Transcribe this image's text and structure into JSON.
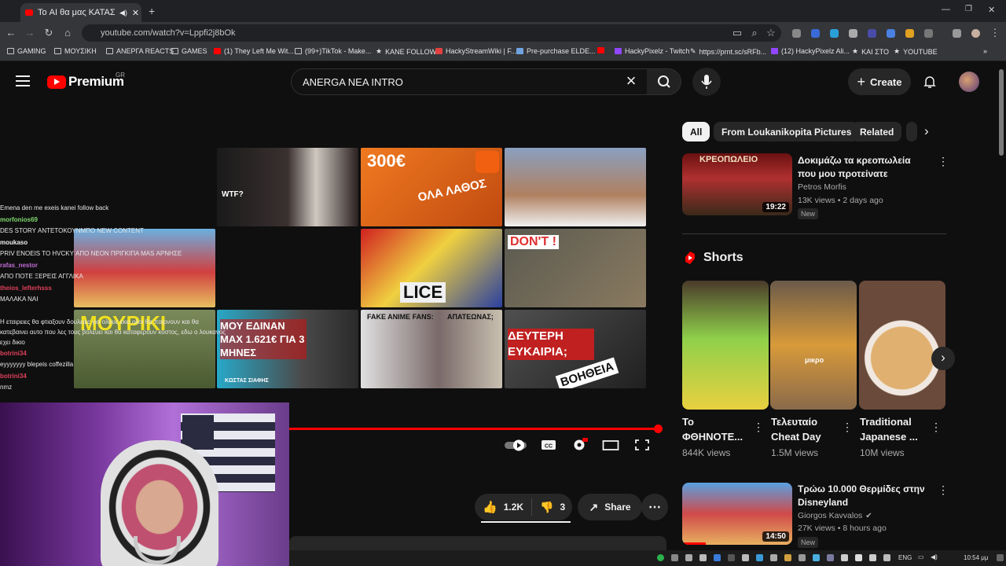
{
  "browser": {
    "tab_title": "Το AI θα μας ΚΑΤΑΣΤΡΕΨΕΙ",
    "url": "youtube.com/watch?v=Lppfi2j8bOk",
    "bookmarks": [
      "GAMING",
      "ΜΟΥΣΙΚΗ",
      "ΑΝΕΡΓΑ REACTS",
      "GAMES",
      "(1) They Left Me Wit...",
      "(99+)TikTok - Make...",
      "ΚΑΝΕ FOLLOW",
      "HackyStreamWiki | F...",
      "Pre-purchase ELDE...",
      "HackyPixelz - Twitch",
      "https://prnt.sc/sRFb...",
      "(12) HackyPixelz Ali...",
      "ΚΑΙ ΣΤΟ",
      "YOUTUBE"
    ]
  },
  "header": {
    "brand": "Premium",
    "country": "GR",
    "search_query": "ANERGA NEA INTRO",
    "create_label": "Create"
  },
  "endscreen": [
    {
      "text": "WTF?",
      "bg": "#2a2a2a"
    },
    {
      "text": "300€",
      "sub": "ΟΛΑ ΛΑΘΟΣ",
      "bg": "#e06a1a"
    },
    {
      "text": "",
      "bg": "#6e7f94"
    },
    {
      "text": "",
      "bg": "#c32020"
    },
    {
      "text": "DON'T !",
      "bg": "#40403a"
    },
    {
      "text": "",
      "bg": "#6aa6d4"
    },
    {
      "text": "ΜΟΥΡΙΚΙ",
      "bg": "#3a5a2a"
    },
    {
      "text": "ΜΟΥ ΕΔΙΝΑΝ ΜΑΧ 1.621€ ΓΙΑ 3 ΜΗΝΕΣ",
      "sub": "ΚΩΣΤΑΣ ΣΙΑΦΗΣ",
      "bg": "#20a0c0"
    },
    {
      "text": "FAKE ANIME FANS:",
      "sub": "ΑΠΑΤΕΩΝΑΣ;",
      "bg": "#d8d8d8"
    },
    {
      "text": "ΔΕΥΤΕΡΗ ΕΥΚΑΙΡΙΑ;",
      "sub": "ΒΟΗΘΕΙΑ",
      "bg": "#303030"
    }
  ],
  "chat": [
    {
      "user": "",
      "msg": "Emena den me exeis kanei follow back"
    },
    {
      "user": "morfonios69",
      "msg": "DES STORY ΑΝΤΕΤΟΚΟΥΝΜΠΟ NEW CONTENT"
    },
    {
      "user": "moukaso",
      "msg": "PRIV ENOEIS TO HVCKY ΑΠΟ ΝΕΟΝ ΠΡΙΓΚΙΠΑ ΜΑS ΑΡΝΗΣΕ"
    },
    {
      "user": "rafas_nestor",
      "msg": "ΑΠΟ ΠΟΤΕ ΞΕΡΕΙΣ ΑΓΓΛΙΚΑ"
    },
    {
      "user": "theios_lefterhsss",
      "msg": "ΜΑΛΑΚΑ ΝΑΙ"
    },
    {
      "user": "",
      "msg": "Η εταιρειες θα φτιαξουν δουλειες για ολους εκει ολοι θα παιρνουν και θα κατεβαινει αυτο που λες τους βολευει και θα καταφερουν κοστος, εδω ο λουκανος εχει δικιο"
    },
    {
      "user": "botrini34",
      "msg": "eyyyyyyy blepeis coffezilla"
    },
    {
      "user": "botrini34",
      "msg": "nmz"
    }
  ],
  "actions": {
    "likes": "1.2K",
    "dislikes": "3",
    "share": "Share"
  },
  "sidebar": {
    "chips": [
      "All",
      "From Loukanikopita Pictures",
      "Related"
    ],
    "top_video": {
      "title": "Δοκιμάζω τα κρεοπωλεία που μου προτείνατε",
      "channel": "Petros Morfis",
      "stats": "13K views • 2 days ago",
      "badge": "New",
      "duration": "19:22",
      "thumb_text": "ΚΡΕΟΠΩΛΕΙΟ"
    },
    "shorts_heading": "Shorts",
    "shorts": [
      {
        "title": "Το ΦΘΗΝΟΤΕ...",
        "views": "844K views",
        "color": "#8fd04a"
      },
      {
        "title": "Τελευταίο Cheat Day",
        "views": "1.5M views",
        "color": "#c08a3a",
        "overlay": "μικρο"
      },
      {
        "title": "Traditional Japanese ...",
        "views": "10M views",
        "color": "#c89a5a"
      }
    ],
    "bottom_video": {
      "title": "Τρώω 10.000 Θερμίδες στην Disneyland",
      "channel": "Giorgos Kavvalos",
      "stats": "27K views • 8 hours ago",
      "badge": "New",
      "duration": "14:50"
    }
  },
  "taskbar": {
    "lang": "ENG",
    "time": "10:54 μμ"
  }
}
